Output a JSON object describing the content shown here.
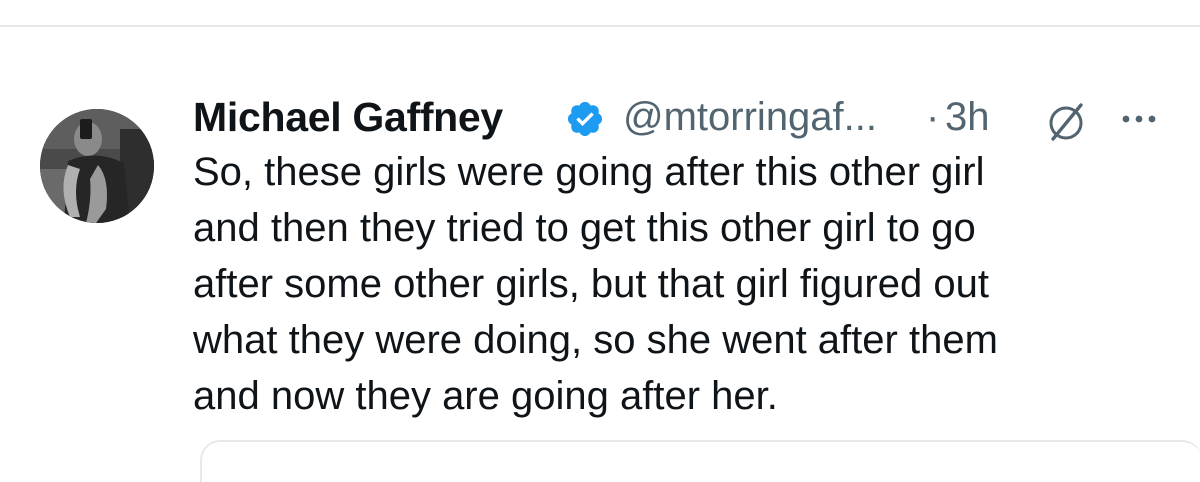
{
  "tweet": {
    "author": {
      "display_name": "Michael Gaffney",
      "handle": "@mtorringaf...",
      "verified": true
    },
    "separator": "·",
    "timestamp": "3h",
    "text_lines": [
      "So, these girls were going after this other girl",
      "and then they tried to get this other girl to go",
      "after some other girls, but that girl figured out",
      "what they were doing, so she went after them",
      "and now they are going after her."
    ]
  },
  "colors": {
    "text_primary": "#0f1419",
    "text_secondary": "#536471",
    "verified_blue": "#1d9bf0",
    "divider": "#e6e9ec"
  },
  "icons": {
    "verified": "verified-badge-icon",
    "grok": "grok-icon",
    "more": "more-horizontal-icon"
  }
}
